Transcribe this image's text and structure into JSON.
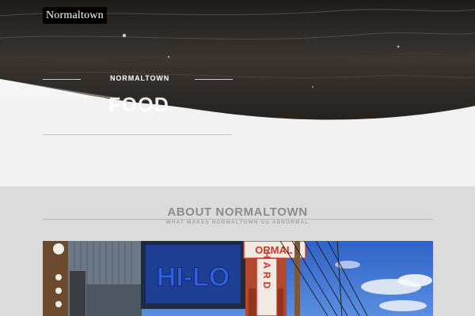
{
  "site": {
    "logo_text": "Normaltown"
  },
  "hero": {
    "kicker": "NORMALTOWN",
    "title": "FOOD"
  },
  "about": {
    "title": "ABOUT NORMALTOWN",
    "subtitle": "WHAT MAKES NORMALTOWN SO ABNORMAL"
  },
  "photo": {
    "sign_left": "HI-LO",
    "sign_top": "ORMAL",
    "sign_vertical": "HARD"
  },
  "colors": {
    "hero_dark": "#2b2724",
    "hero_light": "#f1f1f1",
    "section_bg": "#dbdbdb",
    "sky": "#3a6fd0"
  }
}
